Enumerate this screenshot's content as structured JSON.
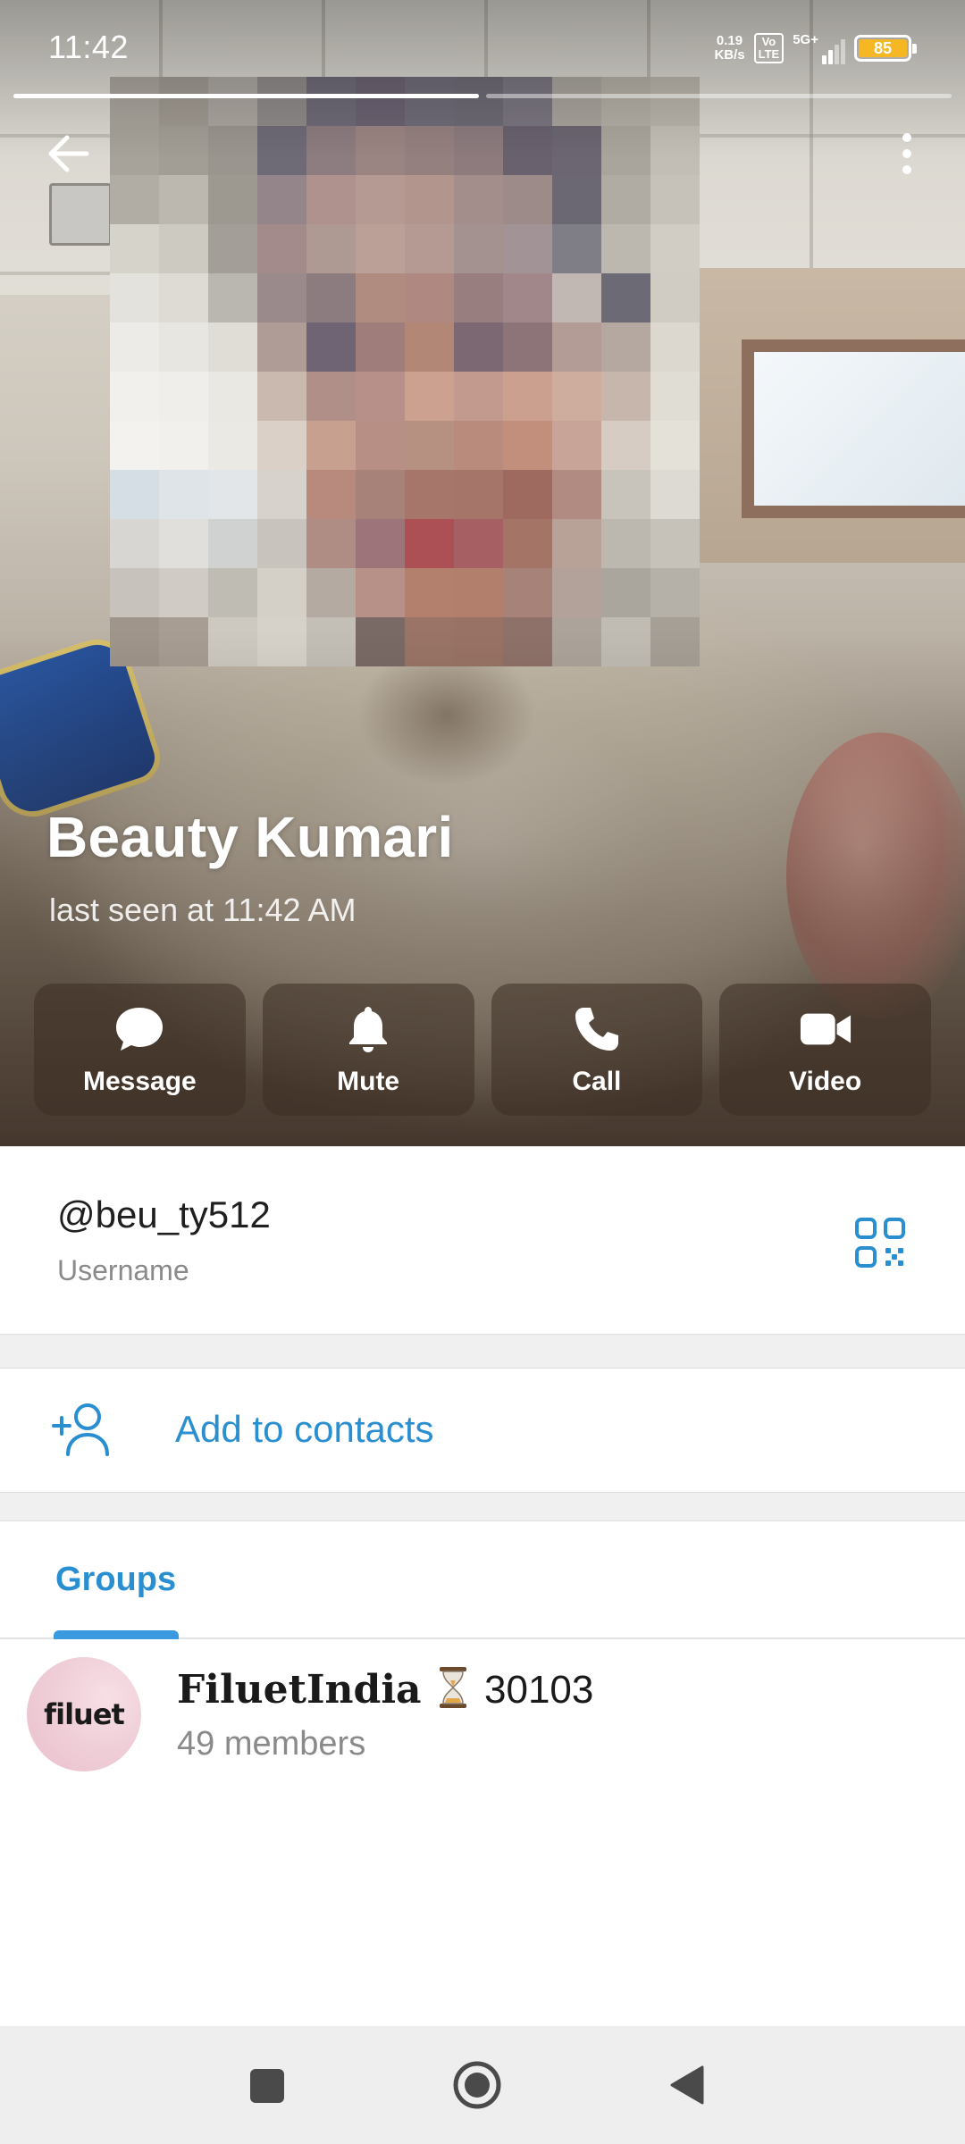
{
  "status_bar": {
    "time": "11:42",
    "net_speed_value": "0.19",
    "net_speed_unit": "KB/s",
    "volte_line1": "Vo",
    "volte_line2": "LTE",
    "signal_label": "5G+",
    "battery": "85",
    "battery_color": "#f5b824"
  },
  "story_progress": {
    "segments": 2,
    "active_index": 0
  },
  "profile": {
    "name": "Beauty Kumari",
    "last_seen": "last seen at 11:42 AM"
  },
  "actions": [
    {
      "label": "Message",
      "icon": "message-icon"
    },
    {
      "label": "Mute",
      "icon": "bell-icon"
    },
    {
      "label": "Call",
      "icon": "phone-icon"
    },
    {
      "label": "Video",
      "icon": "video-icon"
    }
  ],
  "info": {
    "username": "@beu_ty512",
    "username_label": "Username",
    "qr_icon": "qr-code-icon"
  },
  "add_contact": {
    "label": "Add to contacts",
    "icon": "add-person-icon"
  },
  "tabs": [
    {
      "label": "Groups",
      "active": true
    }
  ],
  "groups": [
    {
      "avatar_text": "filuet",
      "title_name": "FiluetIndia",
      "title_suffix": "30103",
      "members": "49 members"
    }
  ],
  "colors": {
    "accent": "#2a8fd0",
    "tab_indicator": "#3a9ae0",
    "secondary_text": "#8a8a8a"
  },
  "nav": {
    "recent": "recent-apps-icon",
    "home": "home-icon",
    "back": "back-triangle-icon"
  }
}
